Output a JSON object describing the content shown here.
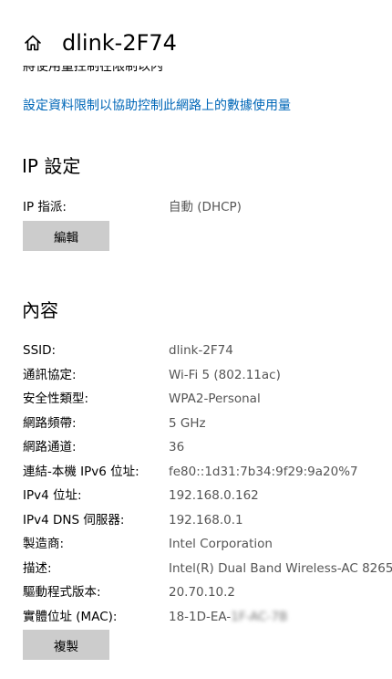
{
  "header": {
    "title": "dlink-2F74"
  },
  "partial_text": "將使用量控制在限制以内",
  "data_limit_link": "設定資料限制以協助控制此網路上的數據使用量",
  "ip_settings": {
    "heading": "IP 設定",
    "assignment_label": "IP 指派:",
    "assignment_value": "自動 (DHCP)",
    "edit_button": "編輯"
  },
  "properties": {
    "heading": "內容",
    "rows": [
      {
        "label": "SSID:",
        "value": "dlink-2F74"
      },
      {
        "label": "通訊協定:",
        "value": "Wi-Fi 5 (802.11ac)"
      },
      {
        "label": "安全性類型:",
        "value": "WPA2-Personal"
      },
      {
        "label": "網路頻帶:",
        "value": "5 GHz"
      },
      {
        "label": "網路通道:",
        "value": "36"
      },
      {
        "label": "連結-本機 IPv6 位址:",
        "value": "fe80::1d31:7b34:9f29:9a20%7"
      },
      {
        "label": "IPv4 位址:",
        "value": "192.168.0.162"
      },
      {
        "label": "IPv4 DNS 伺服器:",
        "value": "192.168.0.1"
      },
      {
        "label": "製造商:",
        "value": "Intel Corporation"
      },
      {
        "label": "描述:",
        "value": "Intel(R) Dual Band Wireless-AC 8265"
      },
      {
        "label": "驅動程式版本:",
        "value": "20.70.10.2"
      },
      {
        "label": "實體位址 (MAC):",
        "value": "18-1D-EA-",
        "value_obscured": "1F-AC-7B"
      }
    ],
    "copy_button": "複製"
  }
}
